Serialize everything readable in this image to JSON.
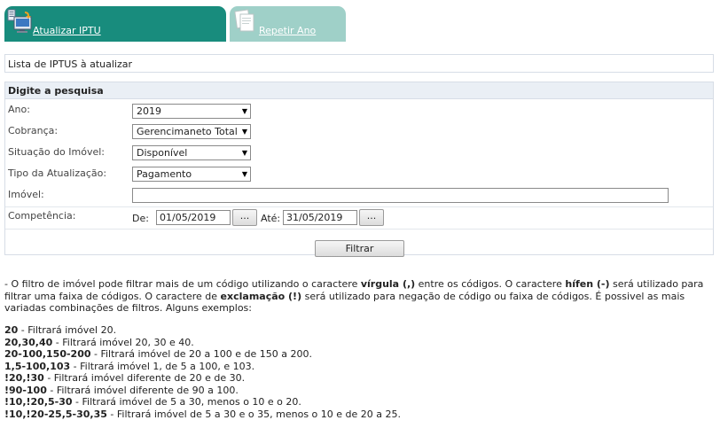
{
  "tabs": [
    {
      "label": "Atualizar IPTU",
      "icon": "monitor-icon"
    },
    {
      "label": "Repetir Ano",
      "icon": "documents-icon"
    }
  ],
  "list_title": "Lista de IPTUS à atualizar",
  "search": {
    "header": "Digite a pesquisa",
    "ano": {
      "label": "Ano:",
      "value": "2019"
    },
    "cobranca": {
      "label": "Cobrança:",
      "value": "Gerencimaneto Total"
    },
    "situacao": {
      "label": "Situação do Imóvel:",
      "value": "Disponível"
    },
    "tipo": {
      "label": "Tipo da Atualização:",
      "value": "Pagamento"
    },
    "imovel": {
      "label": "Imóvel:",
      "value": ""
    },
    "competencia": {
      "label": "Competência:",
      "de_label": "De:",
      "de_value": "01/05/2019",
      "ate_label": "Até:",
      "ate_value": "31/05/2019",
      "picker_label": "..."
    },
    "filter_button": "Filtrar"
  },
  "help": {
    "p1": "- O filtro de imóvel pode filtrar mais de um código utilizando o caractere ",
    "virgula": "vírgula (,)",
    "p2": " entre os códigos. O caractere ",
    "hifen": "hífen (-)",
    "p3": " será utilizado para filtrar uma faixa de códigos. O caractere de ",
    "exclamacao": "exclamação (!)",
    "p4": " será utilizado para negação de código ou faixa de códigos. É possivel as mais variadas combinações de filtros. Alguns exemplos:"
  },
  "examples": [
    {
      "code": "20",
      "desc": " - Filtrará imóvel 20."
    },
    {
      "code": "20,30,40",
      "desc": " - Filtrará imóvel 20, 30 e 40."
    },
    {
      "code": "20-100,150-200",
      "desc": " - Filtrará imóvel de 20 a 100 e de 150 a 200."
    },
    {
      "code": "1,5-100,103",
      "desc": " - Filtrará imóvel 1, de 5 a 100, e 103."
    },
    {
      "code": "!20,!30",
      "desc": " - Filtrará imóvel diferente de 20 e de 30."
    },
    {
      "code": "!90-100",
      "desc": " - Filtrará imóvel diferente de 90 a 100."
    },
    {
      "code": "!10,!20,5-30",
      "desc": " - Filtrará imóvel de 5 a 30, menos o 10 e o 20."
    },
    {
      "code": "!10,!20-25,5-30,35",
      "desc": " - Filtrará imóvel de 5 a 30 e o 35, menos o 10 e de 20 a 25."
    }
  ]
}
